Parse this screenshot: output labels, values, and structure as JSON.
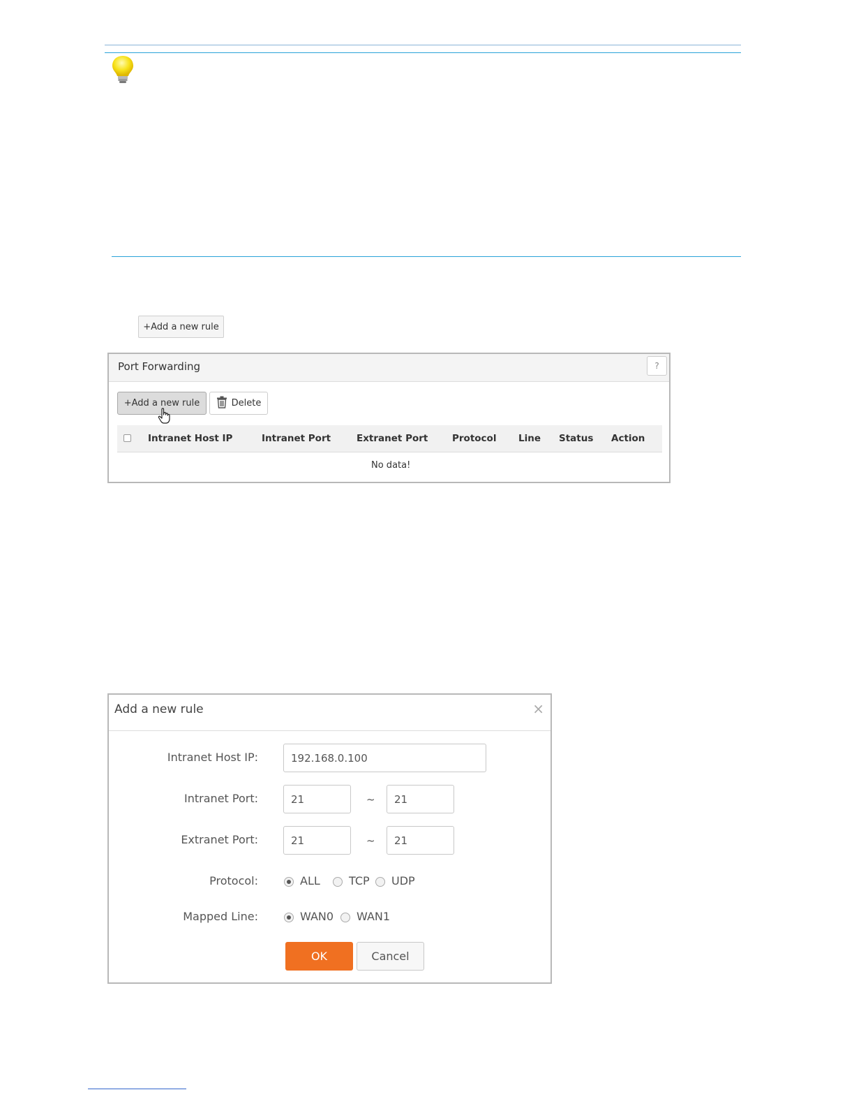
{
  "icons": {
    "note": "lightbulb-icon",
    "delete": "trash-icon",
    "help": "help-icon",
    "close": "close-icon",
    "cursor": "hand-pointer-icon"
  },
  "colors": {
    "accent_line": "#2aa2d9",
    "ok_button": "#f07021",
    "panel_border": "#b8b8b8"
  },
  "standalone_button": {
    "label": "+Add a new rule"
  },
  "port_forwarding": {
    "title": "Port Forwarding",
    "help_label": "?",
    "add_label": "+Add a new rule",
    "delete_label": "Delete",
    "columns": [
      "Intranet Host IP",
      "Intranet Port",
      "Extranet Port",
      "Protocol",
      "Line",
      "Status",
      "Action"
    ],
    "empty_text": "No data!"
  },
  "dialog": {
    "title": "Add a new rule",
    "close_label": "×",
    "host_ip": {
      "label": "Intranet Host IP:",
      "value": "192.168.0.100"
    },
    "intranet_port": {
      "label": "Intranet Port:",
      "from": "21",
      "to": "21",
      "separator": "~"
    },
    "extranet_port": {
      "label": "Extranet Port:",
      "from": "21",
      "to": "21",
      "separator": "~"
    },
    "protocol": {
      "label": "Protocol:",
      "options": [
        "ALL",
        "TCP",
        "UDP"
      ],
      "selected": "ALL"
    },
    "mapped_line": {
      "label": "Mapped Line:",
      "options": [
        "WAN0",
        "WAN1"
      ],
      "selected": "WAN0"
    },
    "ok_label": "OK",
    "cancel_label": "Cancel"
  }
}
